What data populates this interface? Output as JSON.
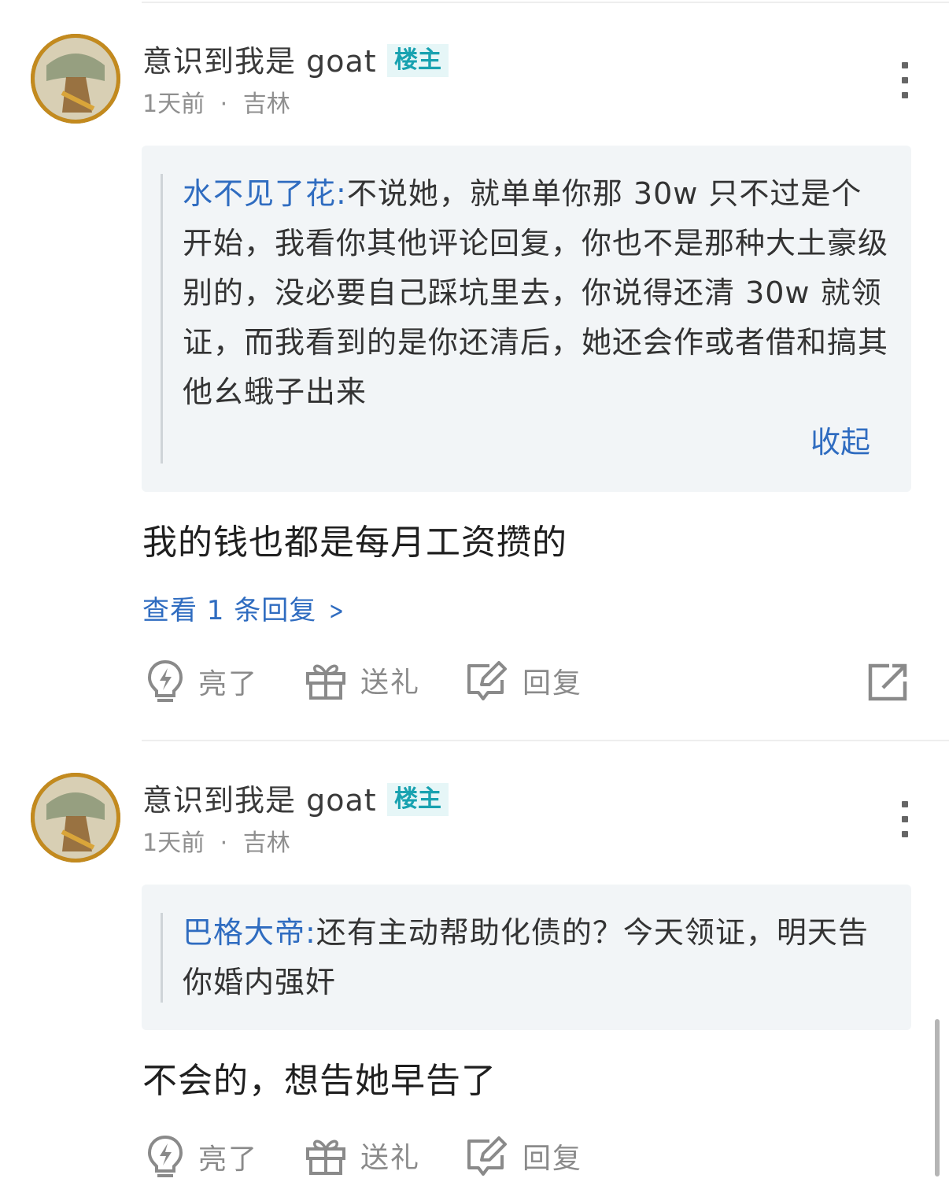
{
  "comments": [
    {
      "username": "意识到我是 goat",
      "badge": "楼主",
      "time": "1天前",
      "separator": "·",
      "location": "吉林",
      "quote": {
        "user": "水不见了花:",
        "text": "不说她，就单单你那 30w 只不过是个开始，我看你其他评论回复，你也不是那种大土豪级别的，没必要自己踩坑里去，你说得还清 30w 就领证，而我看到的是你还清后，她还会作或者借和搞其他幺蛾子出来",
        "collapse_label": "收起"
      },
      "reply": "我的钱也都是每月工资攒的",
      "view_replies": "查看 1 条回复",
      "actions": {
        "like": "亮了",
        "gift": "送礼",
        "reply": "回复"
      }
    },
    {
      "username": "意识到我是 goat",
      "badge": "楼主",
      "time": "1天前",
      "separator": "·",
      "location": "吉林",
      "quote": {
        "user": "巴格大帝:",
        "text": "还有主动帮助化债的？今天领证，明天告你婚内强奸"
      },
      "reply": "不会的，想告她早告了",
      "actions": {
        "like": "亮了",
        "gift": "送礼",
        "reply": "回复"
      }
    }
  ],
  "icons": {
    "more": "more-vertical-icon",
    "like": "lightbulb-icon",
    "gift": "gift-icon",
    "reply": "edit-reply-icon",
    "share": "share-icon"
  }
}
